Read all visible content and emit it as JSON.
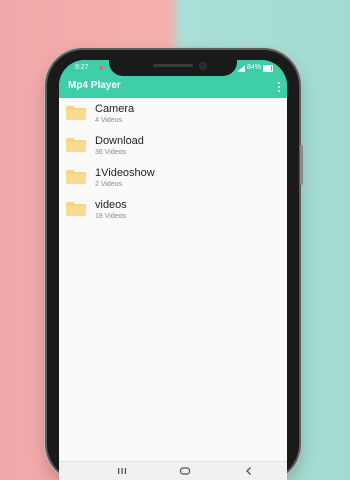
{
  "status": {
    "time": "9:27",
    "battery": "84%"
  },
  "appbar": {
    "title": "Mp4 Player",
    "menu_icon": "more-vert-icon"
  },
  "folders": [
    {
      "name": "Camera",
      "count": "4 Videos",
      "icon": "folder-icon"
    },
    {
      "name": "Download",
      "count": "36 Videos",
      "icon": "folder-icon"
    },
    {
      "name": "1Videoshow",
      "count": "2 Videos",
      "icon": "folder-icon"
    },
    {
      "name": "videos",
      "count": "18 Videos",
      "icon": "folder-icon"
    }
  ],
  "navigation": {
    "recent": "recent-apps-icon",
    "home": "home-icon",
    "back": "back-icon"
  },
  "colors": {
    "accent": "#3ecfa9",
    "folder": "#f4d37a"
  }
}
